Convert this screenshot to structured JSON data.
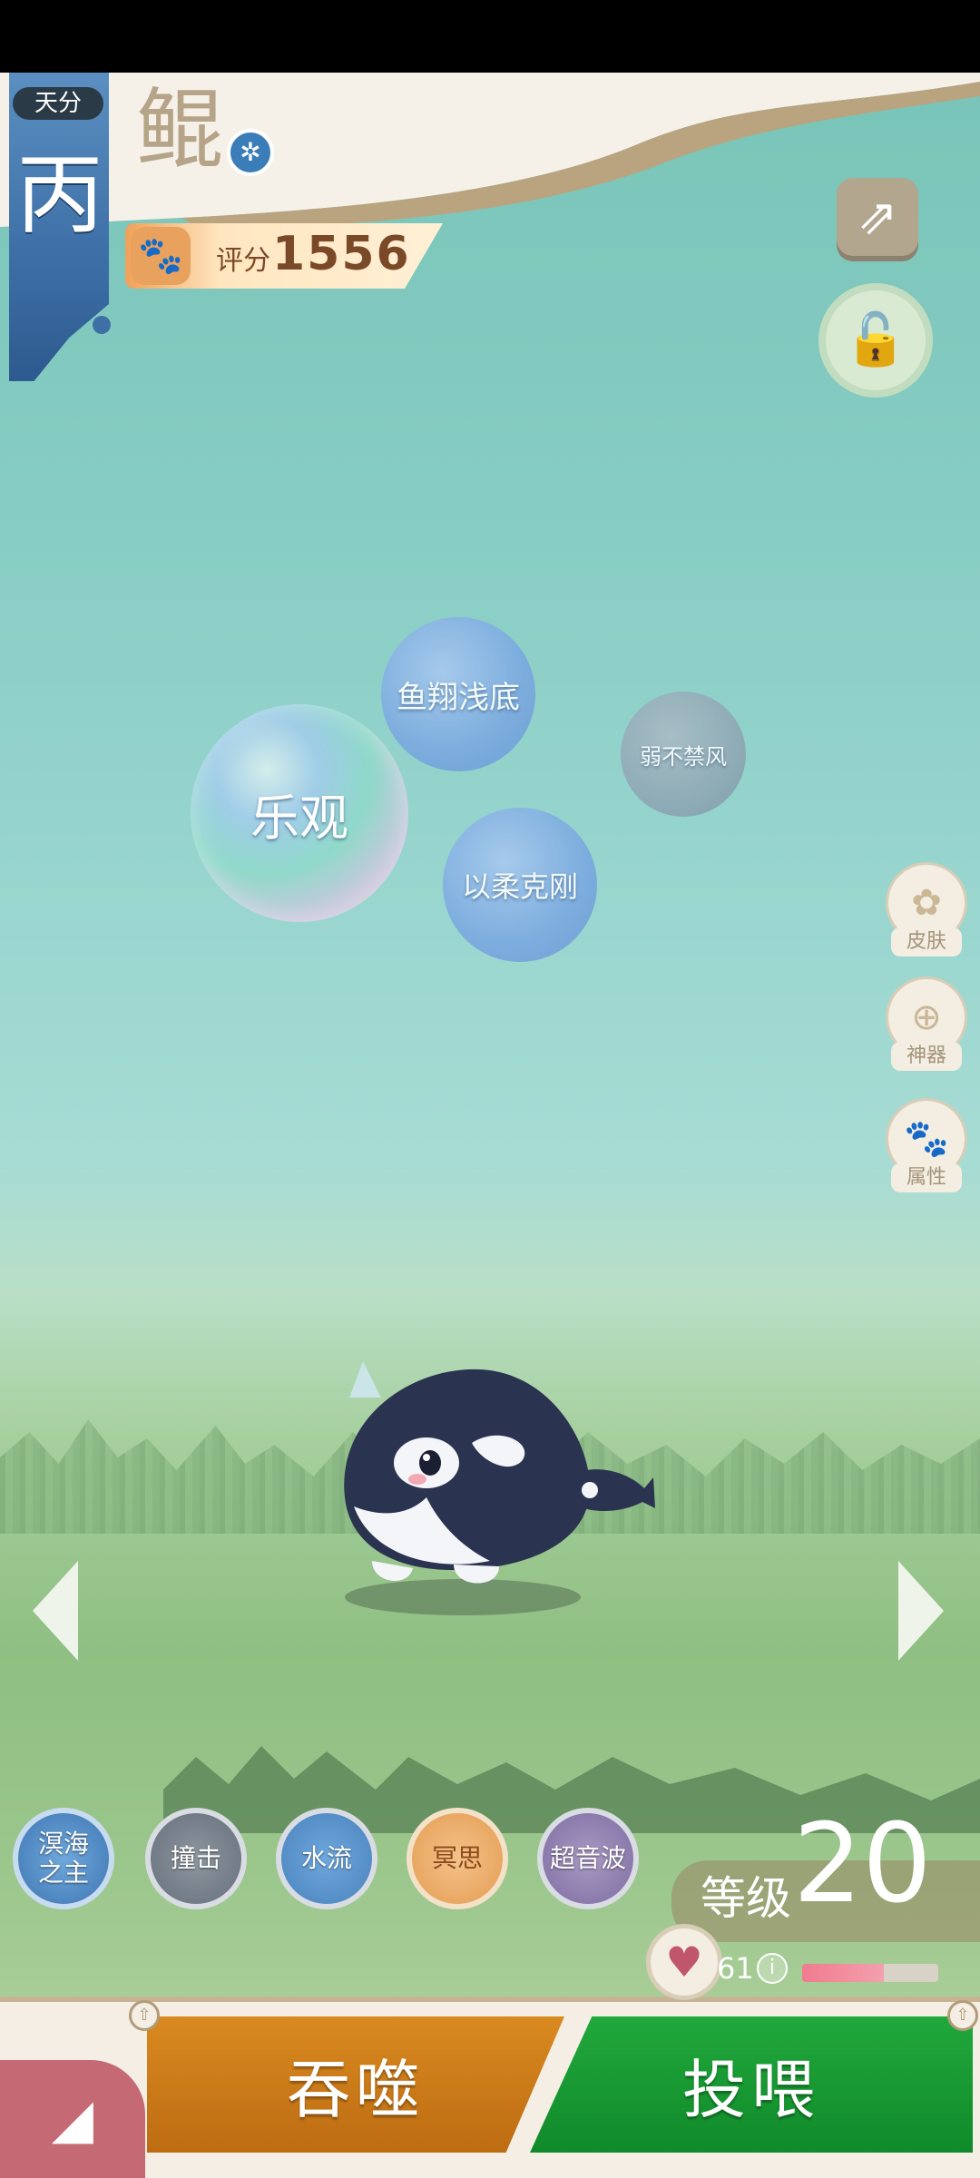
{
  "talent": {
    "tag": "天分",
    "grade": "丙"
  },
  "pet": {
    "species": "鲲",
    "species_icon": "water-element-icon",
    "score_label": "评分",
    "score_value": "1556"
  },
  "top_buttons": {
    "share_icon": "share-icon",
    "lock_icon": "unlock-icon"
  },
  "traits": [
    "乐观",
    "鱼翔浅底",
    "以柔克刚",
    "弱不禁风"
  ],
  "side_menu": [
    {
      "label": "皮肤",
      "icon": "butterfly-icon"
    },
    {
      "label": "神器",
      "icon": "plus-icon"
    },
    {
      "label": "属性",
      "icon": "paw-icon"
    }
  ],
  "skills": [
    "溟海之主",
    "撞击",
    "水流",
    "冥思",
    "超音波"
  ],
  "level": {
    "label": "等级",
    "value": "20"
  },
  "health": {
    "value": "61",
    "fill_fraction": 0.6
  },
  "actions": {
    "devour": "吞噬",
    "feed": "投喂"
  },
  "colors": {
    "devour": "#c97a1a",
    "feed": "#16992f",
    "grade_banner": "#3d6fa6"
  }
}
